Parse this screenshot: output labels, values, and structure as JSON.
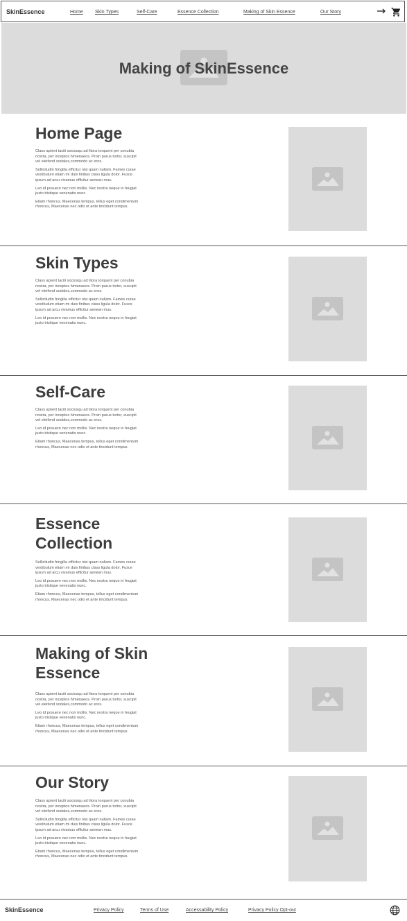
{
  "header": {
    "brand": "SkinEssence",
    "nav": [
      "Home",
      "Skin Types",
      "Self-Care",
      "Essence Collection",
      "Making of Skin Essence",
      "Our Story"
    ],
    "icons": [
      "arrow-right-icon",
      "cart-icon"
    ]
  },
  "hero": {
    "title": "Making of SkinEssence",
    "icon": "image-placeholder-icon"
  },
  "sections": [
    {
      "title": "Home Page",
      "paragraphs": [
        "Class aptent taciti sociosqu ad litora torquent per conubia nostra, per inceptos himenaeos. Proin purus tortor, suscipit vel eleifend sodales,commodo ac eros.",
        "Sollicitudin fringilla efficitur nisi quam nullam. Fames curae vestibulum etiam mi duis finibus class ligula dolor. Fusce ipsum ad arcu vivamus efficitur aenean mus.",
        "Leo id posuere nec non mollis. Nec nostra neque in feugiat justo tristique venenatis nunc.",
        "Etiam rhoncus, Maecenas tempus, tellus eget condimentum rhoncus, Maecenas nec odio et ante tincidunt tempus."
      ]
    },
    {
      "title": "Skin Types",
      "paragraphs": [
        "Class aptent taciti sociosqu ad litora torquent per conubia nostra, per inceptos himenaeos. Proin purus tortor, suscipit vel eleifend sodales,commodo ac eros.",
        "Sollicitudin fringilla efficitur nisi quam nullam. Fames curae vestibulum etiam mi duis finibus class ligula dolor. Fusce ipsum ad arcu vivamus efficitur aenean mus.",
        "Leo id posuere nec non mollis. Nec nostra neque in feugiat justo tristique venenatis nunc."
      ]
    },
    {
      "title": "Self-Care",
      "paragraphs": [
        "Class aptent taciti sociosqu ad litora torquent per conubia nostra, per inceptos himenaeos. Proin purus tortor, suscipit vel eleifend sodales,commodo ac eros.",
        "Leo id posuere nec non mollis. Nec nostra neque in feugiat justo tristique venenatis nunc.",
        "Etiam rhoncus, Maecenas tempus, tellus eget condimentum rhoncus, Maecenas nec odio et ante tincidunt tempus."
      ]
    },
    {
      "title": "Essence Collection",
      "paragraphs": [
        "Sollicitudin fringilla efficitur nisi quam nullam. Fames curae vestibulum etiam mi duis finibus class ligula dolor. Fusce ipsum ad arcu vivamus efficitur aenean mus.",
        "Leo id posuere nec non mollis. Nec nostra neque in feugiat justo tristique venenatis nunc.",
        "Etiam rhoncus, Maecenas tempus, tellus eget condimentum rhoncus, Maecenas nec odio et ante tincidunt tempus."
      ]
    },
    {
      "title": "Making of Skin Essence",
      "paragraphs": [
        "Class aptent taciti sociosqu ad litora torquent per conubia nostra, per inceptos himenaeos. Proin purus tortor, suscipit vel eleifend sodales,commodo ac eros.",
        "Leo id posuere nec non mollis. Nec nostra neque in feugiat justo tristique venenatis nunc.",
        "Etiam rhoncus, Maecenas tempus, tellus eget condimentum rhoncus, Maecenas nec odio et ante tincidunt tempus."
      ]
    },
    {
      "title": "Our Story",
      "paragraphs": [
        "Class aptent taciti sociosqu ad litora torquent per conubia nostra, per inceptos himenaeos. Proin purus tortor, suscipit vel eleifend sodales,commodo ac eros.",
        "Sollicitudin fringilla efficitur nisi quam nullam. Fames curae vestibulum etiam mi duis finibus class ligula dolor. Fusce ipsum ad arcu vivamus efficitur aenean mus.",
        "Leo id posuere nec non mollis. Nec nostra neque in feugiat justo tristique venenatis nunc.",
        "Etiam rhoncus, Maecenas tempus, tellus eget condimentum rhoncus, Maecenas nec odio et ante tincidunt tempus."
      ]
    }
  ],
  "footer": {
    "brand": "SkinEssence",
    "links": [
      "Privacy Policy",
      "Terms of Use",
      "Accessability Policy",
      "Privacy Policy Opt-out"
    ],
    "icon": "globe-icon"
  },
  "colors": {
    "placeholder": "#dcdcdc",
    "border": "#555555",
    "text": "#444444"
  }
}
